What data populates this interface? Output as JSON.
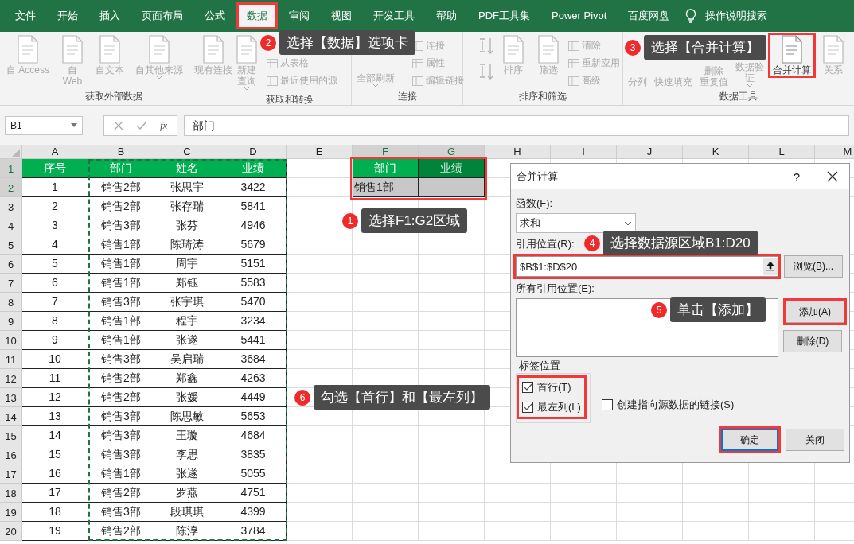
{
  "ribbon_tabs": [
    {
      "label": "文件",
      "selected": false,
      "highlighted": false
    },
    {
      "label": "开始",
      "selected": false,
      "highlighted": false
    },
    {
      "label": "插入",
      "selected": false,
      "highlighted": false
    },
    {
      "label": "页面布局",
      "selected": false,
      "highlighted": false
    },
    {
      "label": "公式",
      "selected": false,
      "highlighted": false
    },
    {
      "label": "数据",
      "selected": true,
      "highlighted": true
    },
    {
      "label": "审阅",
      "selected": false,
      "highlighted": false
    },
    {
      "label": "视图",
      "selected": false,
      "highlighted": false
    },
    {
      "label": "开发工具",
      "selected": false,
      "highlighted": false
    },
    {
      "label": "帮助",
      "selected": false,
      "highlighted": false
    },
    {
      "label": "PDF工具集",
      "selected": false,
      "highlighted": false
    },
    {
      "label": "Power Pivot",
      "selected": false,
      "highlighted": false
    },
    {
      "label": "百度网盘",
      "selected": false,
      "highlighted": false
    }
  ],
  "tell_me": "操作说明搜索",
  "ribbon_groups": [
    {
      "label": "获取外部数据",
      "items": [
        {
          "kind": "large",
          "lines": [
            "自 Access"
          ],
          "dropdown": false,
          "disabled": true,
          "highlighted": false
        },
        {
          "kind": "large",
          "lines": [
            "自",
            "Web"
          ],
          "dropdown": false,
          "disabled": true,
          "highlighted": false
        },
        {
          "kind": "large",
          "lines": [
            "自文本"
          ],
          "dropdown": false,
          "disabled": true,
          "highlighted": false
        },
        {
          "kind": "large",
          "lines": [
            "自其他来源"
          ],
          "dropdown": true,
          "disabled": true,
          "highlighted": false
        },
        {
          "kind": "large",
          "lines": [
            "现有连接"
          ],
          "dropdown": false,
          "disabled": true,
          "highlighted": false
        }
      ]
    },
    {
      "label": "获取和转换",
      "items": [
        {
          "kind": "large",
          "lines": [
            "新建",
            "查询"
          ],
          "dropdown": true,
          "disabled": true,
          "highlighted": false
        },
        {
          "kind": "stack",
          "buttons": [
            {
              "label": "从表格",
              "disabled": true
            },
            {
              "label": "最近使用的源",
              "disabled": true
            }
          ]
        }
      ]
    },
    {
      "label": "连接",
      "items": [
        {
          "kind": "text",
          "lines": [
            "全部刷新"
          ],
          "dropdown": true,
          "disabled": true,
          "highlighted": false
        },
        {
          "kind": "stack",
          "buttons": [
            {
              "label": "连接",
              "disabled": true
            },
            {
              "label": "属性",
              "disabled": true
            },
            {
              "label": "编辑链接",
              "disabled": true
            }
          ]
        }
      ]
    },
    {
      "label": "排序和筛选",
      "items": [
        {
          "kind": "sort_icons"
        },
        {
          "kind": "large",
          "lines": [
            "排序"
          ],
          "dropdown": false,
          "disabled": true,
          "highlighted": false
        },
        {
          "kind": "large",
          "lines": [
            "筛选"
          ],
          "dropdown": false,
          "disabled": true,
          "highlighted": false
        },
        {
          "kind": "stack",
          "buttons": [
            {
              "label": "清除",
              "disabled": true
            },
            {
              "label": "重新应用",
              "disabled": true
            },
            {
              "label": "高级",
              "disabled": true
            }
          ]
        }
      ]
    },
    {
      "label": "数据工具",
      "items": [
        {
          "kind": "text",
          "lines": [
            "分列"
          ],
          "dropdown": false,
          "disabled": true,
          "highlighted": false
        },
        {
          "kind": "text",
          "lines": [
            "快速填充"
          ],
          "dropdown": false,
          "disabled": true,
          "highlighted": false
        },
        {
          "kind": "text",
          "lines": [
            "删除",
            "重复值"
          ],
          "dropdown": false,
          "disabled": true,
          "highlighted": false
        },
        {
          "kind": "text",
          "lines": [
            "数据验",
            "证"
          ],
          "dropdown": true,
          "disabled": true,
          "highlighted": false
        },
        {
          "kind": "large",
          "lines": [
            "合并计算"
          ],
          "dropdown": false,
          "disabled": false,
          "highlighted": true
        },
        {
          "kind": "large",
          "lines": [
            "关系"
          ],
          "dropdown": false,
          "disabled": true,
          "highlighted": false
        }
      ]
    }
  ],
  "name_box": "B1",
  "function_button": "fx",
  "formula": "部门",
  "column_letters": [
    {
      "label": "A",
      "selected": false
    },
    {
      "label": "B",
      "selected": false
    },
    {
      "label": "C",
      "selected": false
    },
    {
      "label": "D",
      "selected": false
    },
    {
      "label": "E",
      "selected": false
    },
    {
      "label": "F",
      "selected": true
    },
    {
      "label": "G",
      "selected": true
    },
    {
      "label": "H",
      "selected": false
    },
    {
      "label": "I",
      "selected": false
    },
    {
      "label": "J",
      "selected": false
    },
    {
      "label": "K",
      "selected": false
    },
    {
      "label": "L",
      "selected": false
    },
    {
      "label": "M",
      "selected": false
    }
  ],
  "row_numbers": [
    {
      "label": "1",
      "selected": true
    },
    {
      "label": "2",
      "selected": true
    },
    {
      "label": "3",
      "selected": false
    },
    {
      "label": "4",
      "selected": false
    },
    {
      "label": "5",
      "selected": false
    },
    {
      "label": "6",
      "selected": false
    },
    {
      "label": "7",
      "selected": false
    },
    {
      "label": "8",
      "selected": false
    },
    {
      "label": "9",
      "selected": false
    },
    {
      "label": "10",
      "selected": false
    },
    {
      "label": "11",
      "selected": false
    },
    {
      "label": "12",
      "selected": false
    },
    {
      "label": "13",
      "selected": false
    },
    {
      "label": "14",
      "selected": false
    },
    {
      "label": "15",
      "selected": false
    },
    {
      "label": "16",
      "selected": false
    },
    {
      "label": "17",
      "selected": false
    },
    {
      "label": "18",
      "selected": false
    },
    {
      "label": "19",
      "selected": false
    },
    {
      "label": "20",
      "selected": false
    }
  ],
  "data_table": {
    "columns": [
      "序号",
      "部门",
      "姓名",
      "业绩"
    ],
    "rows": [
      [
        "1",
        "销售2部",
        "张思宇",
        "3422"
      ],
      [
        "2",
        "销售2部",
        "张存瑞",
        "5841"
      ],
      [
        "3",
        "销售3部",
        "张芬",
        "4946"
      ],
      [
        "4",
        "销售1部",
        "陈琦涛",
        "5679"
      ],
      [
        "5",
        "销售1部",
        "周宇",
        "5151"
      ],
      [
        "6",
        "销售1部",
        "郑钰",
        "5583"
      ],
      [
        "7",
        "销售3部",
        "张宇琪",
        "5470"
      ],
      [
        "8",
        "销售1部",
        "程宇",
        "3234"
      ],
      [
        "9",
        "销售1部",
        "张遂",
        "5441"
      ],
      [
        "10",
        "销售3部",
        "吴启瑞",
        "3684"
      ],
      [
        "11",
        "销售2部",
        "郑鑫",
        "4263"
      ],
      [
        "12",
        "销售2部",
        "张媛",
        "4449"
      ],
      [
        "13",
        "销售3部",
        "陈思敏",
        "5653"
      ],
      [
        "14",
        "销售3部",
        "王璇",
        "4684"
      ],
      [
        "15",
        "销售3部",
        "李思",
        "3835"
      ],
      [
        "16",
        "销售1部",
        "张遂",
        "5055"
      ],
      [
        "17",
        "销售2部",
        "罗燕",
        "4751"
      ],
      [
        "18",
        "销售3部",
        "段琪琪",
        "4399"
      ],
      [
        "19",
        "销售2部",
        "陈淳",
        "3784"
      ]
    ]
  },
  "result_table": {
    "selected": true,
    "highlighted": true,
    "columns": [
      "部门",
      "业绩"
    ],
    "rows": [
      [
        "销售1部"
      ]
    ]
  },
  "dialog": {
    "title": "合并计算",
    "help": "?",
    "function_label": "函数(F):",
    "function_value": "求和",
    "reference_label": "引用位置(R):",
    "reference_value": "$B$1:$D$20",
    "reference_highlighted": true,
    "browse_button": "浏览(B)...",
    "all_references_label": "所有引用位置(E):",
    "add_button": "添加(A)",
    "add_highlighted": true,
    "delete_button": "删除(D)",
    "labels_group": "标签位置",
    "checkboxes": [
      {
        "label": "首行(T)",
        "checked": true
      },
      {
        "label": "最左列(L)",
        "checked": true
      },
      {
        "label": "创建指向源数据的链接(S)",
        "checked": false
      }
    ],
    "checks_highlighted": true,
    "ok_button": "确定",
    "ok_highlighted": true,
    "close_button": "关闭"
  },
  "callouts": [
    {
      "number": "1",
      "text": "选择F1:G2区域"
    },
    {
      "number": "2",
      "text": "选择【数据】选项卡"
    },
    {
      "number": "3",
      "text": "选择【合并计算】"
    },
    {
      "number": "4",
      "text": "选择数据源区域B1:D20"
    },
    {
      "number": "5",
      "text": "单击【添加】"
    },
    {
      "number": "6",
      "text": "勾选【首行】和【最左列】"
    }
  ]
}
